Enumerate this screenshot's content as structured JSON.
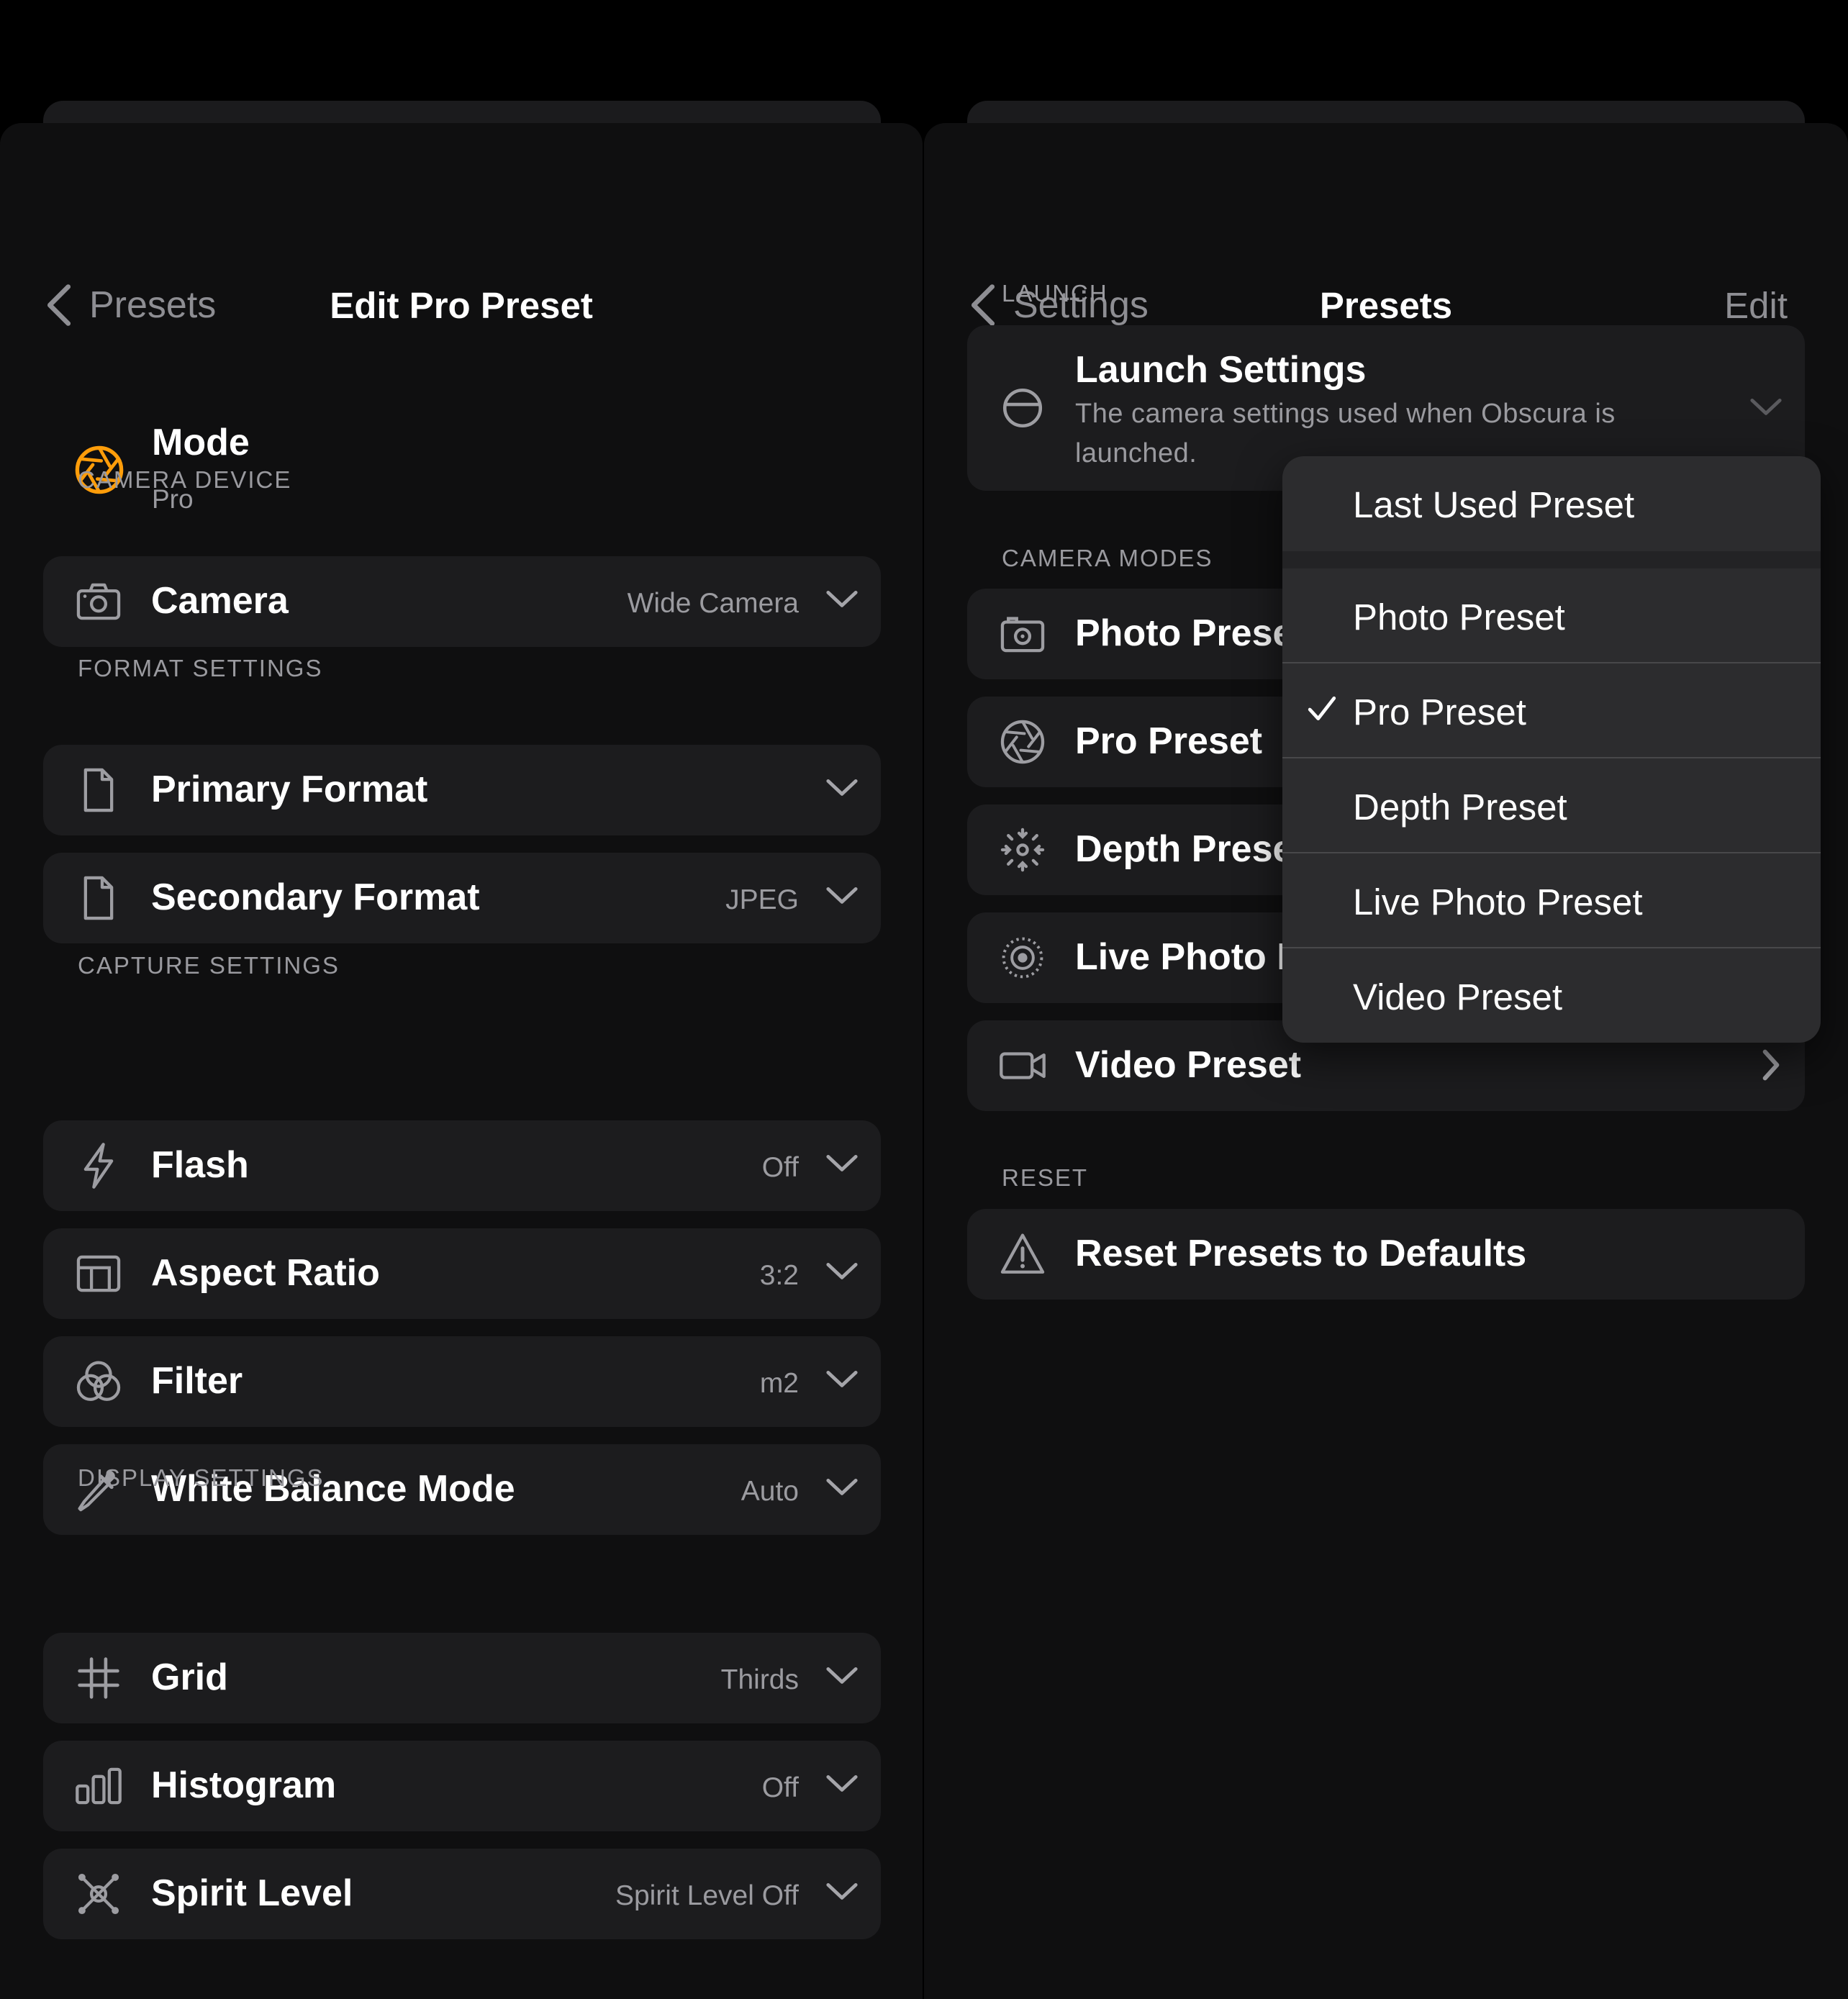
{
  "left_panel": {
    "nav": {
      "back_label": "Presets",
      "title": "Edit Pro Preset"
    },
    "mode": {
      "title": "Mode",
      "value": "Pro",
      "icon": "aperture-icon",
      "accent_color": "#ff9d0a"
    },
    "sections": {
      "camera_device": "CAMERA DEVICE",
      "format_settings": "FORMAT SETTINGS",
      "capture_settings": "CAPTURE SETTINGS",
      "display_settings": "DISPLAY SETTINGS"
    },
    "rows": {
      "camera": {
        "label": "Camera",
        "value": "Wide Camera",
        "icon": "camera-icon"
      },
      "primary_format": {
        "label": "Primary Format",
        "value": "",
        "icon": "document-icon"
      },
      "secondary_format": {
        "label": "Secondary Format",
        "value": "JPEG",
        "icon": "document-icon"
      },
      "flash": {
        "label": "Flash",
        "value": "Off",
        "icon": "bolt-icon"
      },
      "aspect_ratio": {
        "label": "Aspect Ratio",
        "value": "3:2",
        "icon": "aspect-ratio-icon"
      },
      "filter": {
        "label": "Filter",
        "value": "m2",
        "icon": "filter-circles-icon"
      },
      "white_balance": {
        "label": "White Balance Mode",
        "value": "Auto",
        "icon": "eyedropper-icon"
      },
      "grid": {
        "label": "Grid",
        "value": "Thirds",
        "icon": "grid-icon"
      },
      "histogram": {
        "label": "Histogram",
        "value": "Off",
        "icon": "histogram-icon"
      },
      "spirit_level": {
        "label": "Spirit Level",
        "value": "Spirit Level Off",
        "icon": "spirit-level-icon"
      }
    }
  },
  "right_panel": {
    "nav": {
      "back_label": "Settings",
      "title": "Presets",
      "edit_label": "Edit"
    },
    "sections": {
      "launch": "LAUNCH",
      "camera_modes": "CAMERA MODES",
      "reset": "RESET"
    },
    "launch_settings": {
      "title": "Launch Settings",
      "description": "The camera settings used when Obscura is launched.",
      "icon": "launch-circle-icon"
    },
    "camera_modes": [
      {
        "label": "Photo Preset",
        "icon": "photo-camera-icon"
      },
      {
        "label": "Pro Preset",
        "icon": "aperture-icon"
      },
      {
        "label": "Depth Preset",
        "icon": "depth-icon"
      },
      {
        "label": "Live Photo Preset",
        "icon": "live-photo-icon"
      },
      {
        "label": "Video Preset",
        "icon": "video-camera-icon"
      }
    ],
    "reset_row": {
      "label": "Reset Presets to Defaults",
      "icon": "warning-icon"
    }
  },
  "dropdown": {
    "items": [
      {
        "label": "Last Used Preset",
        "checked": false
      },
      {
        "label": "Photo Preset",
        "checked": false
      },
      {
        "label": "Pro Preset",
        "checked": true
      },
      {
        "label": "Depth Preset",
        "checked": false
      },
      {
        "label": "Live Photo Preset",
        "checked": false
      },
      {
        "label": "Video Preset",
        "checked": false
      }
    ]
  }
}
